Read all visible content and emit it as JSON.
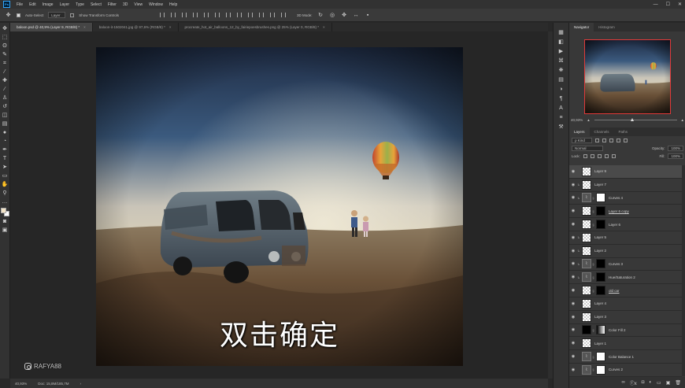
{
  "menubar": {
    "logo": "Ps",
    "items": [
      "File",
      "Edit",
      "Image",
      "Layer",
      "Type",
      "Select",
      "Filter",
      "3D",
      "View",
      "Window",
      "Help"
    ],
    "controls": [
      "—",
      "☐",
      "✕"
    ]
  },
  "options": {
    "auto_select_label": "Auto-Select",
    "auto_select_target": "Layer",
    "transform_label": "Show Transform Controls",
    "mode_label": "3D Mode:"
  },
  "tabs": [
    {
      "label": "baloon.psd @ 40,9% (Layer 9, RGB/8) *",
      "active": true
    },
    {
      "label": "baloon-it-1502041.jpg @ 97,6% (RGB/8) *",
      "active": false
    },
    {
      "label": "procreate_hot_air_balloons_12_by_fairiepoesbrushes.png @ 25% (Layer 0, RGB/8) *",
      "active": false
    }
  ],
  "canvas": {
    "subtitle": "双击确定",
    "watermark": "RAFYA88"
  },
  "status": {
    "zoom": "40,93%",
    "doc": "Doc: 15,8M/185,7M"
  },
  "navigator": {
    "tabs": [
      "Navigator",
      "Histogram"
    ],
    "zoom": "40,93%",
    "zoom_fraction": 0.44
  },
  "layers_panel": {
    "tabs": [
      "Layers",
      "Channels",
      "Paths"
    ],
    "kind_label": "ρ Kind",
    "blend_mode": "Normal",
    "opacity_label": "Opacity:",
    "opacity_value": "100%",
    "lock_label": "Lock:",
    "fill_label": "Fill:",
    "fill_value": "100%",
    "layers": [
      {
        "name": "Layer 9",
        "thumb": "checker",
        "mask": null,
        "selected": true,
        "clip": false,
        "underline": false
      },
      {
        "name": "Layer 7",
        "thumb": "checker",
        "mask": null,
        "selected": false,
        "clip": true,
        "underline": false
      },
      {
        "name": "Curves 4",
        "thumb": "adj",
        "mask": "white",
        "selected": false,
        "clip": true,
        "underline": false
      },
      {
        "name": "Layer 6 copy",
        "thumb": "checker",
        "mask": "black",
        "selected": false,
        "clip": false,
        "underline": true
      },
      {
        "name": "Layer 6",
        "thumb": "checker",
        "mask": "black",
        "selected": false,
        "clip": false,
        "underline": false
      },
      {
        "name": "Layer 5",
        "thumb": "checker",
        "mask": null,
        "selected": false,
        "clip": true,
        "underline": false
      },
      {
        "name": "Layer 2",
        "thumb": "checker",
        "mask": null,
        "selected": false,
        "clip": true,
        "underline": false
      },
      {
        "name": "Curves 3",
        "thumb": "adj",
        "mask": "black",
        "selected": false,
        "clip": true,
        "underline": false
      },
      {
        "name": "Hue/Saturation 2",
        "thumb": "adj",
        "mask": "black",
        "selected": false,
        "clip": true,
        "underline": false
      },
      {
        "name": "old car",
        "thumb": "checker",
        "mask": "black",
        "selected": false,
        "clip": false,
        "underline": true
      },
      {
        "name": "Layer 4",
        "thumb": "checker",
        "mask": null,
        "selected": false,
        "clip": false,
        "underline": false
      },
      {
        "name": "Layer 3",
        "thumb": "checker",
        "mask": null,
        "selected": false,
        "clip": false,
        "underline": false
      },
      {
        "name": "Color Fill 2",
        "thumb": "black",
        "mask": "grad",
        "selected": false,
        "clip": false,
        "underline": false
      },
      {
        "name": "Layer 1",
        "thumb": "checker",
        "mask": null,
        "selected": false,
        "clip": false,
        "underline": false
      },
      {
        "name": "Color Balance 1",
        "thumb": "adj",
        "mask": "white",
        "selected": false,
        "clip": false,
        "underline": false
      },
      {
        "name": "Curves 2",
        "thumb": "adj",
        "mask": "white",
        "selected": false,
        "clip": false,
        "underline": false
      }
    ],
    "footer_icons": [
      "ⓕx",
      "◘",
      "◐",
      "▭",
      "▣",
      "🗑"
    ]
  },
  "colors": {
    "selection_border": "#e03a3a",
    "foreground_swatch": "#f2e3c6"
  }
}
